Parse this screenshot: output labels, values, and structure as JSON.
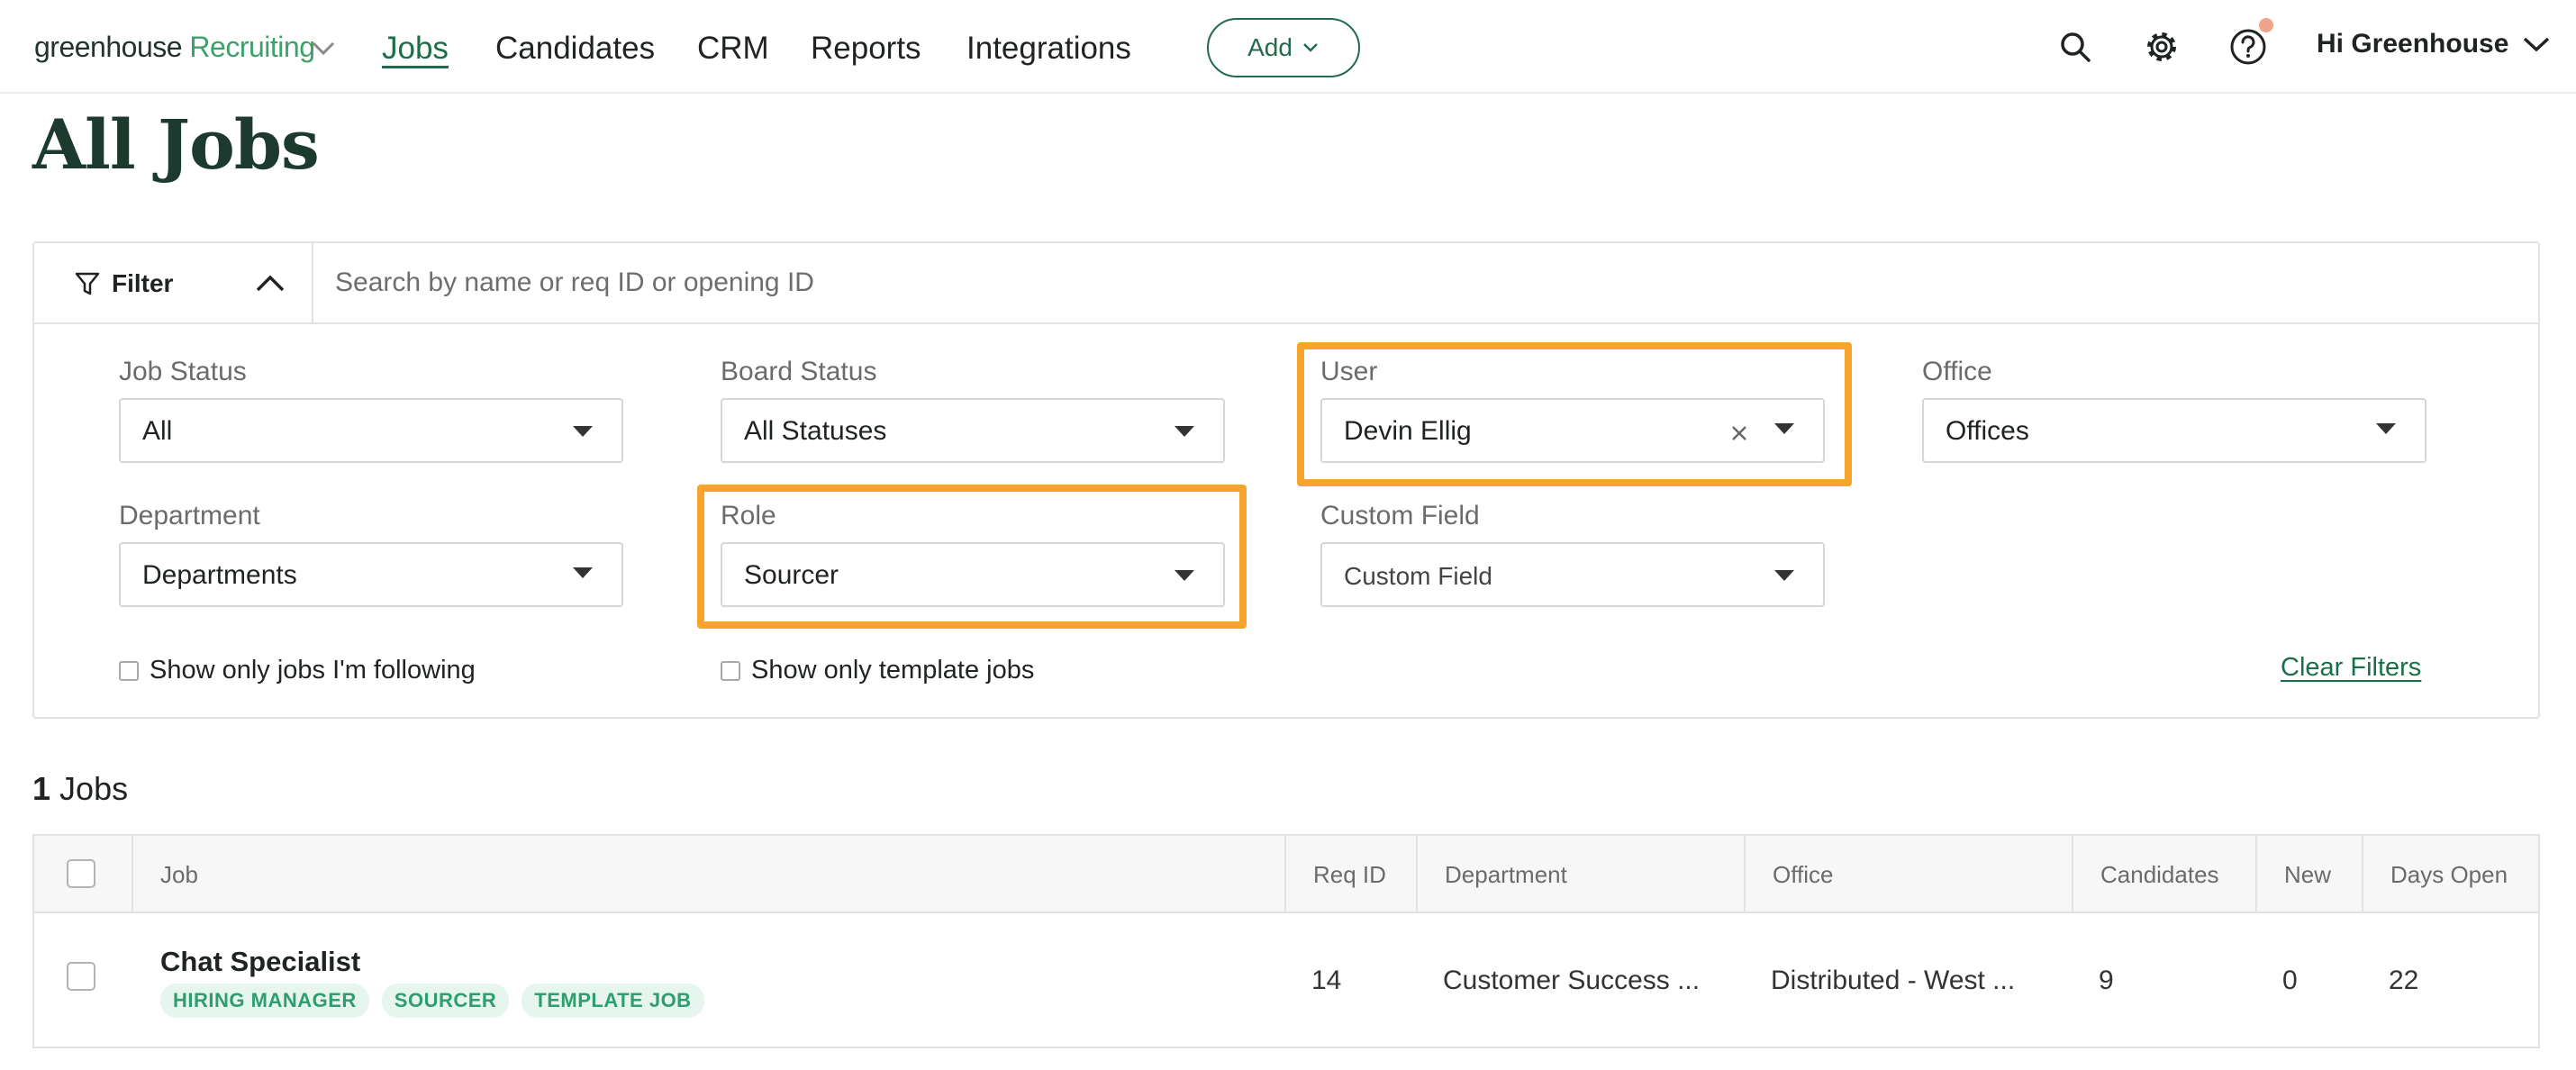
{
  "nav": {
    "logo_text": "greenhouse",
    "logo_suffix": "Recruiting",
    "items": [
      {
        "label": "Jobs",
        "active": true
      },
      {
        "label": "Candidates"
      },
      {
        "label": "CRM"
      },
      {
        "label": "Reports"
      },
      {
        "label": "Integrations"
      }
    ],
    "add_label": "Add",
    "user_greeting": "Hi Greenhouse",
    "icons": [
      "search-icon",
      "gear-icon",
      "help-icon",
      "chevron-down-icon"
    ]
  },
  "page": {
    "title": "All Jobs"
  },
  "filters": {
    "toggle_label": "Filter",
    "search_placeholder": "Search by name or req ID or opening ID",
    "job_status": {
      "label": "Job Status",
      "value": "All"
    },
    "board_status": {
      "label": "Board Status",
      "value": "All Statuses"
    },
    "user": {
      "label": "User",
      "value": "Devin Ellig"
    },
    "office": {
      "label": "Office",
      "value": "Offices"
    },
    "department": {
      "label": "Department",
      "value": "Departments"
    },
    "role": {
      "label": "Role",
      "value": "Sourcer"
    },
    "custom_field": {
      "label": "Custom Field",
      "value": "Custom Field"
    },
    "following_label": "Show only jobs I'm following",
    "template_label": "Show only template jobs",
    "clear_label": "Clear Filters",
    "highlight_color": "#f6a42c"
  },
  "results": {
    "count": "1",
    "count_suffix": "Jobs"
  },
  "table": {
    "columns": [
      "Job",
      "Req ID",
      "Department",
      "Office",
      "Candidates",
      "New",
      "Days Open"
    ],
    "rows": [
      {
        "job": "Chat Specialist",
        "tags": [
          "HIRING MANAGER",
          "SOURCER",
          "TEMPLATE JOB"
        ],
        "req_id": "14",
        "department": "Customer Success ...",
        "office": "Distributed - West ...",
        "candidates": "9",
        "new": "0",
        "days_open": "22"
      }
    ]
  }
}
